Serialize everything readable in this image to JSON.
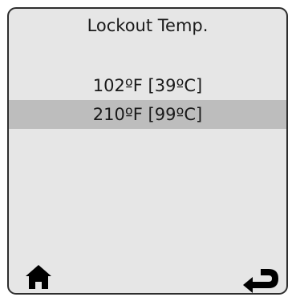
{
  "screen": {
    "title": "Lockout Temp."
  },
  "options": [
    {
      "label": "102ºF [39ºC]",
      "selected": false
    },
    {
      "label": "210ºF [99ºC]",
      "selected": true
    }
  ],
  "footer": {
    "home_icon": "home-icon",
    "back_icon": "return-arrow-icon"
  },
  "colors": {
    "panel_background": "#e6e6e6",
    "selected_row": "#bdbdbd",
    "border": "#2e2e2e",
    "icon": "#000000"
  }
}
